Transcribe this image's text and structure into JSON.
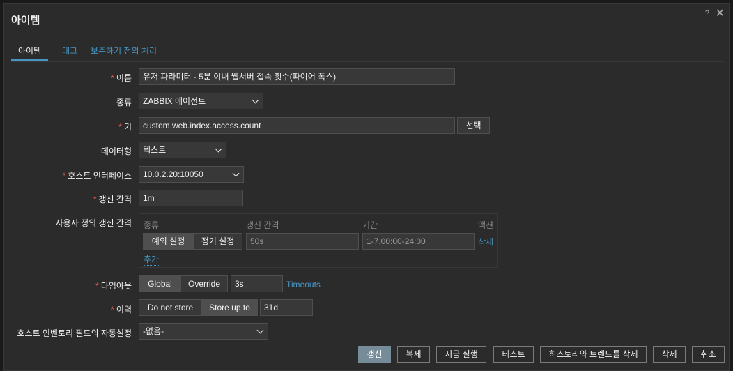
{
  "dialog": {
    "title": "아이템",
    "help": "?",
    "close": "✕"
  },
  "tabs": [
    {
      "label": "아이템"
    },
    {
      "label": "태그"
    },
    {
      "label": "보존하기 전의 처리"
    }
  ],
  "form": {
    "name": {
      "label": "이름",
      "value": "유저 파라미터 - 5분 이내 웹서버 접속 횟수(파이어 폭스)"
    },
    "type": {
      "label": "종류",
      "value": "ZABBIX 에이전트"
    },
    "key": {
      "label": "키",
      "value": "custom.web.index.access.count",
      "select_button": "선택"
    },
    "datatype": {
      "label": "데이터형",
      "value": "텍스트"
    },
    "interface": {
      "label": "호스트 인터페이스",
      "value": "10.0.2.20:10050"
    },
    "interval": {
      "label": "갱신 간격",
      "value": "1m"
    },
    "custom_intervals": {
      "label": "사용자 정의 갱신 간격",
      "headers": {
        "type": "종류",
        "interval": "갱신 간격",
        "period": "기간",
        "action": "액션"
      },
      "row": {
        "mode_flexible": "예외 설정",
        "mode_scheduling": "정기 설정",
        "interval_placeholder": "50s",
        "period_placeholder": "1-7,00:00-24:00",
        "remove": "삭제"
      },
      "add": "추가"
    },
    "timeout": {
      "label": "타임아웃",
      "global": "Global",
      "override": "Override",
      "value": "3s",
      "link": "Timeouts"
    },
    "history": {
      "label": "이력",
      "do_not_store": "Do not store",
      "store_up_to": "Store up to",
      "value": "31d"
    },
    "inventory": {
      "label": "호스트 인벤토리 필드의 자동설정",
      "value": "-없음-"
    }
  },
  "footer": {
    "update": "갱신",
    "clone": "복제",
    "execute_now": "지금 실행",
    "test": "테스트",
    "clear_history": "히스토리와 트렌드를 삭제",
    "delete": "삭제",
    "cancel": "취소"
  },
  "colors": {
    "accent": "#4796c4",
    "required": "#e45959",
    "primary_button": "#768d99"
  }
}
